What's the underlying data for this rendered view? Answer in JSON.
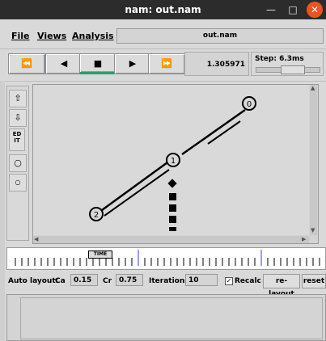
{
  "window": {
    "title": "nam: out.nam"
  },
  "menu": {
    "file": "File",
    "views": "Views",
    "analysis": "Analysis",
    "filename": "out.nam"
  },
  "controls": {
    "rewind_icon": "⏪",
    "back_icon": "◀",
    "stop_icon": "■",
    "play_icon": "▶",
    "ff_icon": "⏩",
    "time": "1.305971",
    "step_label": "Step: 6.3ms"
  },
  "tools": {
    "edit_label": "ED IT"
  },
  "network": {
    "nodes": [
      {
        "id": "0",
        "label": "0"
      },
      {
        "id": "1",
        "label": "1"
      },
      {
        "id": "2",
        "label": "2"
      }
    ]
  },
  "timeline": {
    "badge": "TIME"
  },
  "autolayout": {
    "label": "Auto layout:",
    "ca_label": "Ca",
    "ca_value": "0.15",
    "cr_label": "Cr",
    "cr_value": "0.75",
    "iter_label": "Iterations",
    "iter_value": "10",
    "recalc_label": "Recalc",
    "relayout_label": "re-layout",
    "reset_label": "reset"
  },
  "colors": {
    "accent": "#2a9d6e",
    "close": "#e95420"
  }
}
